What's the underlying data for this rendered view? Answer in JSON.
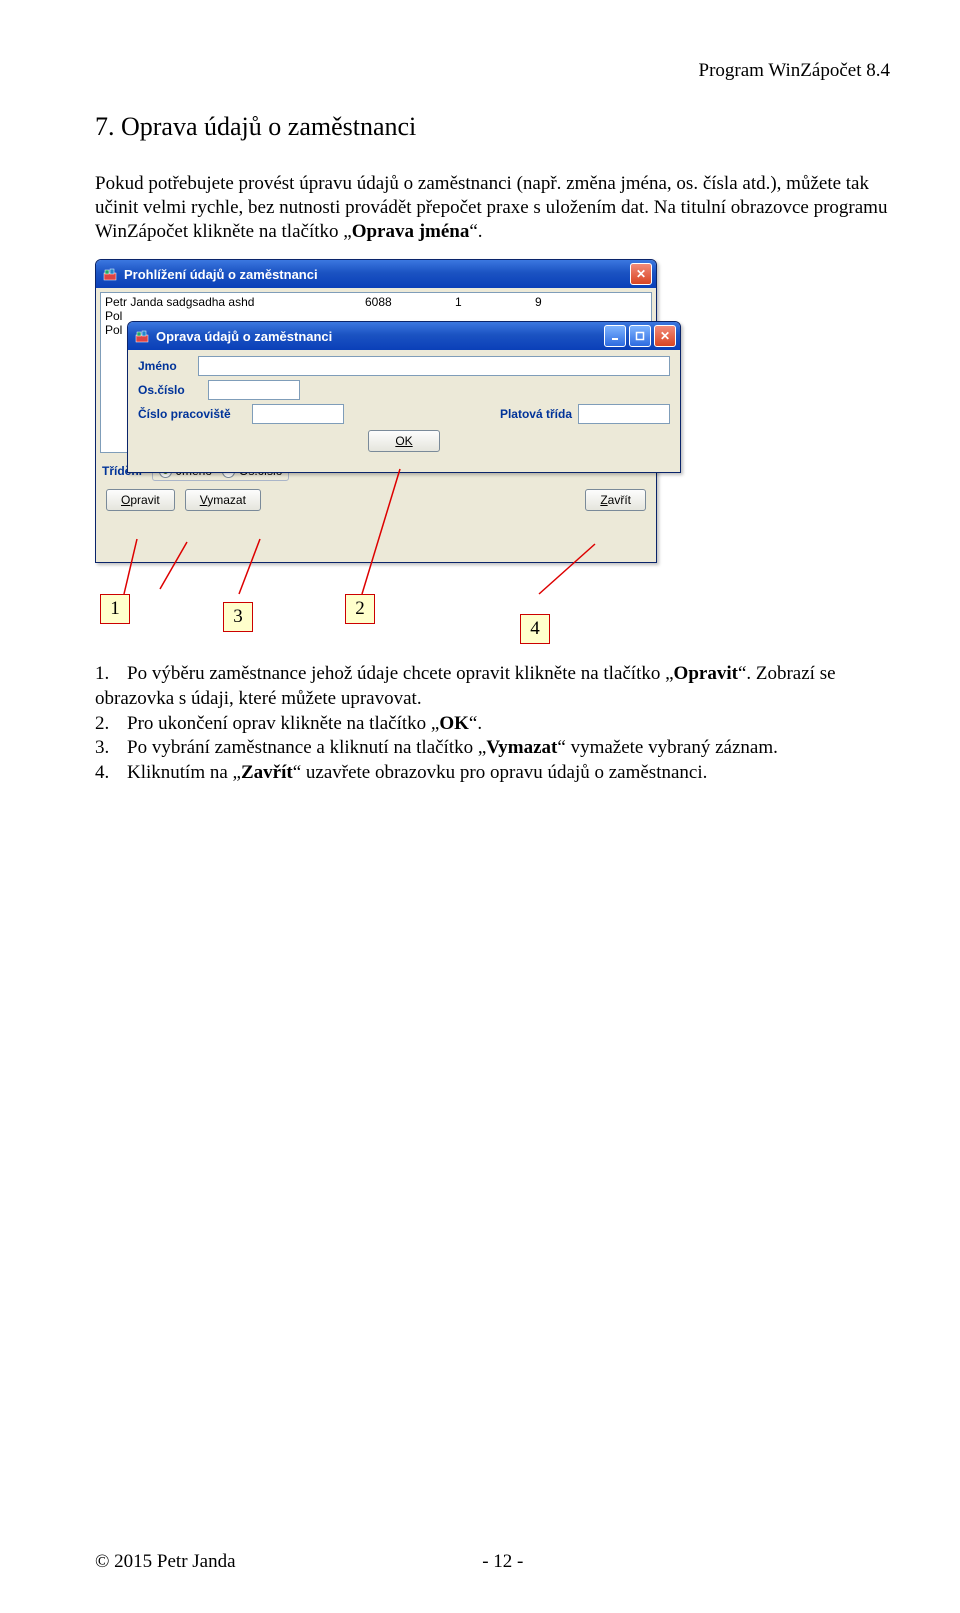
{
  "header": {
    "program_name": "Program WinZápočet 8.4"
  },
  "heading": "7. Oprava údajů o zaměstnanci",
  "para1": {
    "t1": "Pokud potřebujete provést úpravu údajů o zaměstnanci (např. změna jména, os. čísla atd.), můžete tak učinit velmi rychle, bez nutnosti provádět přepočet praxe s uložením dat. Na titulní obrazovce programu WinZápočet klikněte na tlačítko „",
    "bold": "Oprava jména",
    "t2": "“."
  },
  "screenshot": {
    "win1": {
      "title": "Prohlížení údajů o zaměstnanci",
      "row": {
        "c1": "Petr Janda sadgsadha ashd",
        "c2": "6088",
        "c3": "1",
        "c4": "9"
      },
      "row_prefix1": "Pol",
      "row_prefix2": "Pol",
      "sort_label": "Třídění",
      "radio1": "Jméno",
      "radio2": "Os.číslo",
      "btn_edit": "Opravit",
      "btn_delete": "Vymazat",
      "btn_close": "Zavřít"
    },
    "win2": {
      "title": "Oprava údajů o zaměstnanci",
      "lbl_name": "Jméno",
      "lbl_osc": "Os.číslo",
      "lbl_prac": "Číslo pracoviště",
      "lbl_trida": "Platová třída",
      "btn_ok": "OK"
    }
  },
  "numbers": {
    "n1": "1",
    "n2": "2",
    "n3": "3",
    "n4": "4"
  },
  "instructions": {
    "i1a": "Po výběru zaměstnance jehož údaje chcete opravit klikněte na tlačítko „",
    "i1b": "Opravit",
    "i1c": "“. Zobrazí se obrazovka s údaji, které můžete upravovat.",
    "i2a": "Pro ukončení oprav klikněte na tlačítko „",
    "i2b": "OK",
    "i2c": "“.",
    "i3a": "Po vybrání zaměstnance a kliknutí na tlačítko „",
    "i3b": "Vymazat",
    "i3c": "“ vymažete vybraný záznam.",
    "i4a": "Kliknutím na „",
    "i4b": "Zavřít",
    "i4c": "“ uzavřete obrazovku pro opravu údajů o zaměstnanci.",
    "n1": "1.",
    "n2": "2.",
    "n3": "3.",
    "n4": "4."
  },
  "footer": {
    "copyright": "© 2015 Petr Janda",
    "page": "- 12 -"
  }
}
